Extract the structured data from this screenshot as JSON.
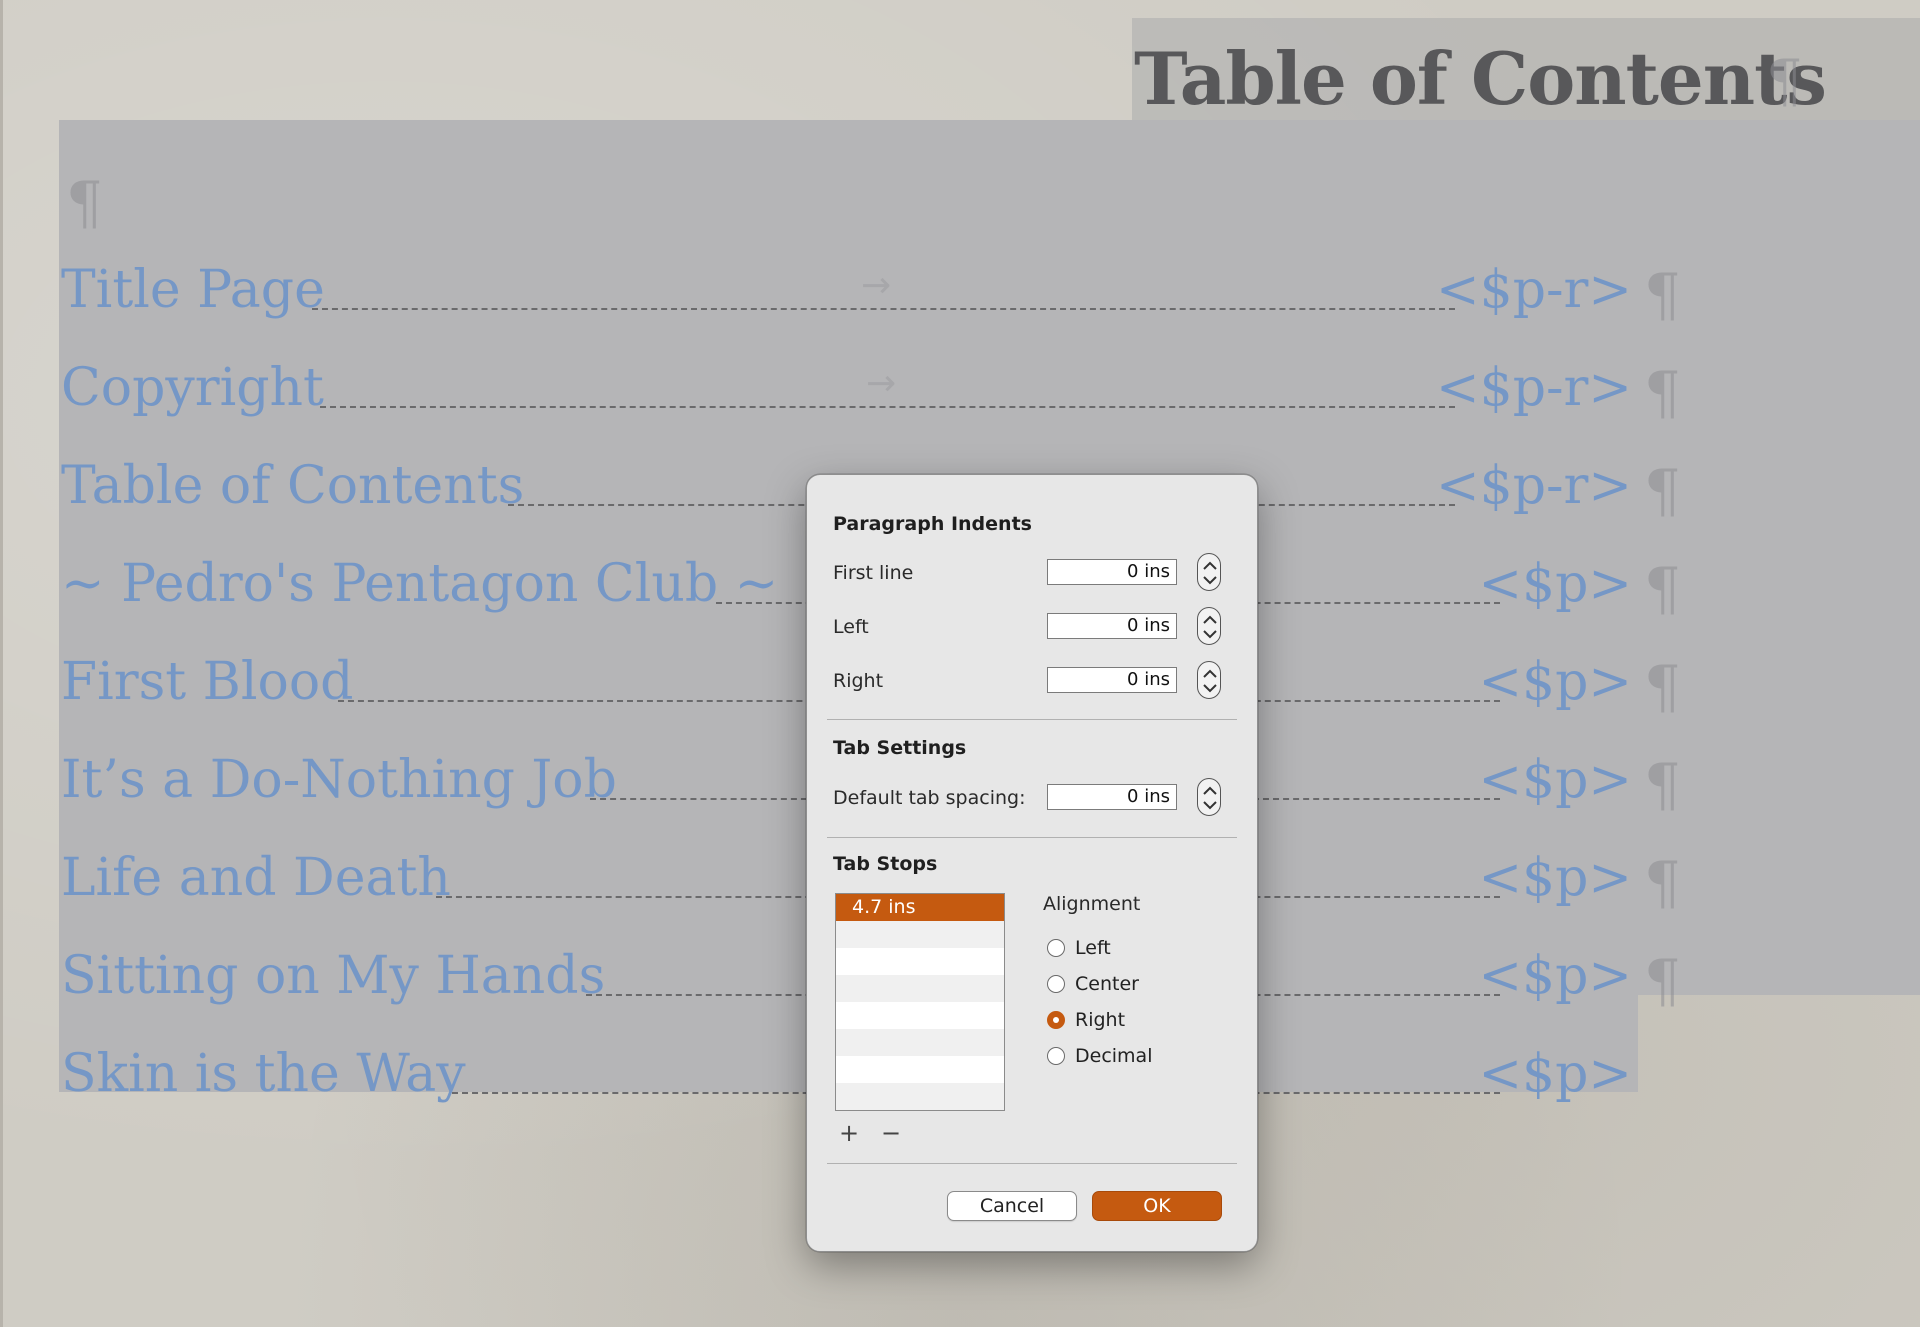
{
  "document": {
    "heading": "Table of Contents",
    "pilcrow": "¶",
    "tab_arrow": "→",
    "entries": [
      {
        "label": "Title Page",
        "page": "<$p-r>"
      },
      {
        "label": "Copyright",
        "page": "<$p-r>"
      },
      {
        "label": "Table of Contents",
        "page": "<$p-r>"
      },
      {
        "label": "~ Pedro's Pentagon Club ~",
        "page": "<$p>"
      },
      {
        "label": "First Blood",
        "page": "<$p>"
      },
      {
        "label": "It’s a Do-Nothing Job",
        "page": "<$p>"
      },
      {
        "label": "Life and Death",
        "page": "<$p>"
      },
      {
        "label": "Sitting on My Hands",
        "page": "<$p>"
      },
      {
        "label": "Skin is the Way",
        "page": "<$p>"
      }
    ]
  },
  "dialog": {
    "paragraph_indents": {
      "title": "Paragraph Indents",
      "first_line": {
        "label": "First line",
        "value": "0 ins"
      },
      "left": {
        "label": "Left",
        "value": "0 ins"
      },
      "right": {
        "label": "Right",
        "value": "0 ins"
      }
    },
    "tab_settings": {
      "title": "Tab Settings",
      "default_spacing": {
        "label": "Default tab spacing:",
        "value": "0 ins"
      }
    },
    "tab_stops": {
      "title": "Tab Stops",
      "items": [
        "4.7 ins"
      ],
      "selected_index": 0,
      "add_label": "+",
      "remove_label": "−"
    },
    "alignment": {
      "title": "Alignment",
      "options": [
        "Left",
        "Center",
        "Right",
        "Decimal"
      ],
      "selected": "Right"
    },
    "buttons": {
      "cancel": "Cancel",
      "ok": "OK"
    }
  },
  "colors": {
    "accent": "#c55a10",
    "selection": "#b5b5b7",
    "entry_text": "#7597c6",
    "heading_text": "#58585a"
  }
}
